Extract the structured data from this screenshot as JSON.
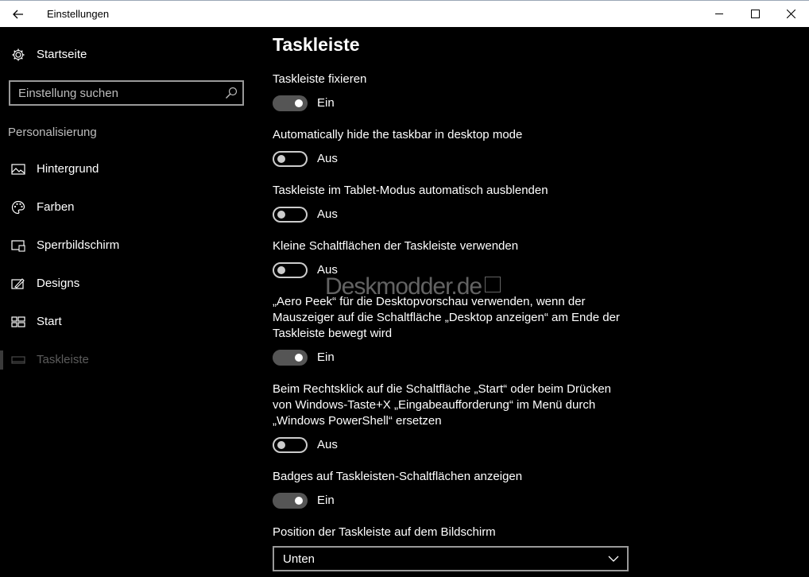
{
  "window": {
    "title": "Einstellungen",
    "icons": {
      "back": "back-arrow-icon",
      "minimize": "minimize-icon",
      "maximize": "maximize-icon",
      "close": "close-icon"
    }
  },
  "sidebar": {
    "home_label": "Startseite",
    "search_placeholder": "Einstellung suchen",
    "section_heading": "Personalisierung",
    "items": [
      {
        "label": "Hintergrund",
        "icon": "picture-icon"
      },
      {
        "label": "Farben",
        "icon": "palette-icon"
      },
      {
        "label": "Sperrbildschirm",
        "icon": "lockscreen-icon"
      },
      {
        "label": "Designs",
        "icon": "brush-icon"
      },
      {
        "label": "Start",
        "icon": "start-grid-icon"
      },
      {
        "label": "Taskleiste",
        "icon": "taskbar-icon",
        "active": true
      }
    ]
  },
  "main": {
    "title": "Taskleiste",
    "settings": [
      {
        "label": "Taskleiste fixieren",
        "state": "Ein",
        "on": true
      },
      {
        "label": "Automatically hide the taskbar in desktop mode",
        "state": "Aus",
        "on": false
      },
      {
        "label": "Taskleiste im Tablet-Modus automatisch ausblenden",
        "state": "Aus",
        "on": false
      },
      {
        "label": "Kleine Schaltflächen der Taskleiste verwenden",
        "state": "Aus",
        "on": false
      },
      {
        "label": "„Aero Peek“ für die Desktopvorschau verwenden, wenn der Mauszeiger auf die Schaltfläche „Desktop anzeigen“ am Ende der Taskleiste bewegt wird",
        "state": "Ein",
        "on": true
      },
      {
        "label": "Beim Rechtsklick auf die Schaltfläche „Start“ oder beim Drücken von Windows-Taste+X „Eingabeaufforderung“ im Menü durch „Windows PowerShell“ ersetzen",
        "state": "Aus",
        "on": false
      },
      {
        "label": "Badges auf Taskleisten-Schaltflächen anzeigen",
        "state": "Ein",
        "on": true
      }
    ],
    "position_label": "Position der Taskleiste auf dem Bildschirm",
    "position_value": "Unten"
  },
  "watermark": "Deskmodder.de",
  "colors": {
    "background": "#000000",
    "titlebar": "#ffffff",
    "toggle_on": "#555555",
    "inactive_text": "#5c5c5c"
  }
}
